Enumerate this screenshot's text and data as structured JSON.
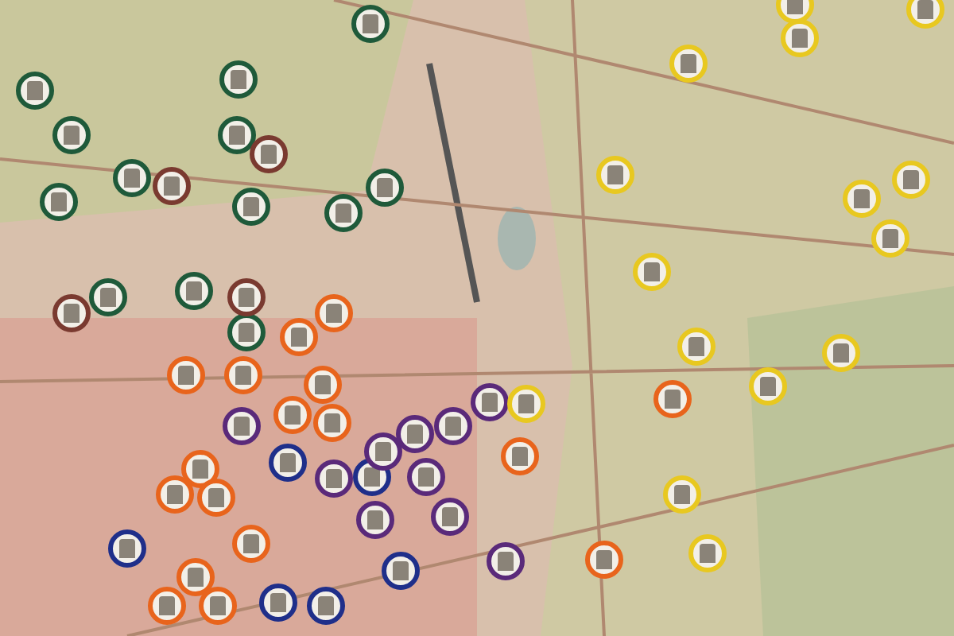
{
  "map": {
    "pins": [
      {
        "color": "#1f5a3a"
      },
      {
        "color": "#1f5a3a"
      },
      {
        "color": "#1f5a3a"
      },
      {
        "color": "#1f5a3a"
      },
      {
        "color": "#1f5a3a"
      },
      {
        "color": "#7a3a30"
      },
      {
        "color": "#1f5a3a"
      },
      {
        "color": "#7a3a30"
      },
      {
        "color": "#1f5a3a"
      },
      {
        "color": "#1f5a3a"
      },
      {
        "color": "#1f5a3a"
      },
      {
        "color": "#1f5a3a"
      },
      {
        "color": "#1f5a3a"
      },
      {
        "color": "#1f5a3a"
      },
      {
        "color": "#7a3a30"
      },
      {
        "color": "#1f5a3a"
      },
      {
        "color": "#7a3a30"
      },
      {
        "color": "#e8641c"
      },
      {
        "color": "#e8641c"
      },
      {
        "color": "#e8641c"
      },
      {
        "color": "#e8641c"
      },
      {
        "color": "#e8641c"
      },
      {
        "color": "#e8641c"
      },
      {
        "color": "#e8641c"
      },
      {
        "color": "#e8641c"
      },
      {
        "color": "#e8641c"
      },
      {
        "color": "#e8641c"
      },
      {
        "color": "#e8641c"
      },
      {
        "color": "#e8641c"
      },
      {
        "color": "#e8641c"
      },
      {
        "color": "#e8641c"
      },
      {
        "color": "#e8641c"
      },
      {
        "color": "#e8641c"
      },
      {
        "color": "#e8641c"
      },
      {
        "color": "#1f2f8a"
      },
      {
        "color": "#1f2f8a"
      },
      {
        "color": "#1f2f8a"
      },
      {
        "color": "#1f2f8a"
      },
      {
        "color": "#1f2f8a"
      },
      {
        "color": "#1f2f8a"
      },
      {
        "color": "#5a2a7a"
      },
      {
        "color": "#5a2a7a"
      },
      {
        "color": "#5a2a7a"
      },
      {
        "color": "#5a2a7a"
      },
      {
        "color": "#5a2a7a"
      },
      {
        "color": "#5a2a7a"
      },
      {
        "color": "#5a2a7a"
      },
      {
        "color": "#5a2a7a"
      },
      {
        "color": "#5a2a7a"
      },
      {
        "color": "#5a2a7a"
      },
      {
        "color": "#e8c820"
      },
      {
        "color": "#e8c820"
      },
      {
        "color": "#e8c820"
      },
      {
        "color": "#e8c820"
      },
      {
        "color": "#e8c820"
      },
      {
        "color": "#e8c820"
      },
      {
        "color": "#e8c820"
      },
      {
        "color": "#e8c820"
      },
      {
        "color": "#e8c820"
      },
      {
        "color": "#e8c820"
      },
      {
        "color": "#e8c820"
      },
      {
        "color": "#e8c820"
      },
      {
        "color": "#e8c820"
      },
      {
        "color": "#e8c820"
      },
      {
        "color": "#e8c820"
      }
    ]
  }
}
